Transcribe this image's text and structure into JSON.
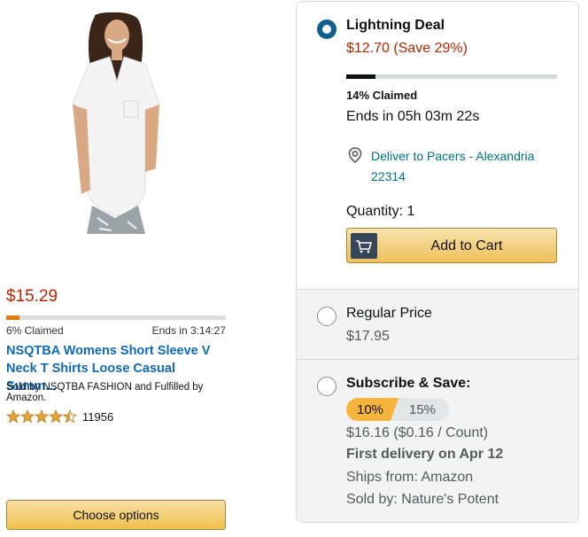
{
  "product": {
    "price": "$15.29",
    "claimed_fraction": 0.06,
    "claimed_label": "6% Claimed",
    "ends_in": "Ends in 3:14:27",
    "title": "NSQTBA Womens Short Sleeve V Neck T Shirts Loose Casual Summ...",
    "sold_by": "Sold by NSQTBA FASHION and Fulfilled by Amazon.",
    "rating_stars": 4.5,
    "review_count": "11956",
    "choose_options_label": "Choose options"
  },
  "buy_box": {
    "lightning": {
      "title": "Lightning Deal",
      "price_line": "$12.70 (Save 29%)",
      "claimed_fraction": 0.14,
      "claimed_label": "14% Claimed",
      "ends_in": "Ends in 05h 03m 22s",
      "deliver_to": "Deliver to Pacers - Alexandria 22314",
      "quantity": "Quantity: 1",
      "add_to_cart": "Add to Cart"
    },
    "regular": {
      "title": "Regular Price",
      "price": "$17.95"
    },
    "subscribe": {
      "title": "Subscribe & Save:",
      "discount_options": [
        "10%",
        "15%"
      ],
      "selected_discount": "10%",
      "price": "$16.16 ($0.16 / Count)",
      "first_delivery": "First delivery on Apr 12",
      "ships_from": "Ships from: Amazon",
      "sold_by": "Sold by: Nature's Potent"
    }
  },
  "colors": {
    "price_red": "#B12704",
    "link_blue": "#0F6BB6",
    "radio_selected": "#0F5E8E",
    "button_gold": "#F0C14B",
    "discount_active": "#F5B53C",
    "star_gold": "#E3A23A"
  },
  "icons": [
    "location-pin-icon",
    "cart-icon",
    "star-icon"
  ]
}
